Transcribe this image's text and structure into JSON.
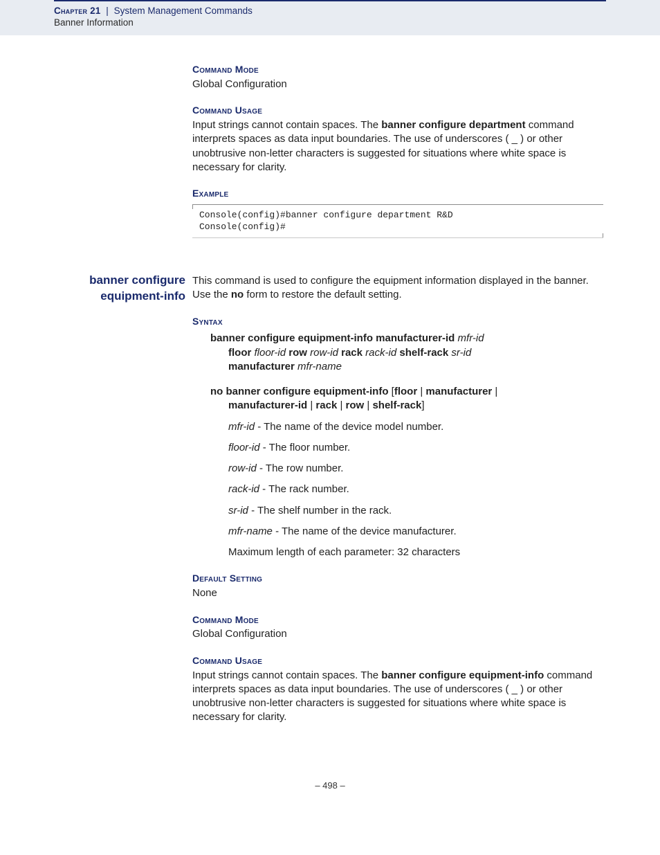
{
  "header": {
    "chapter": "Chapter 21",
    "sep": "|",
    "title": "System Management Commands",
    "sub": "Banner Information"
  },
  "s1": {
    "cmd_mode_label": "Command Mode",
    "cmd_mode_body": "Global Configuration",
    "cmd_usage_label": "Command Usage",
    "usage_pre": "Input strings cannot contain spaces. The ",
    "usage_bold": "banner configure department",
    "usage_post": " command interprets spaces as data input boundaries. The use of underscores ( _ ) or other unobtrusive non-letter characters is suggested for situations where white space is necessary for clarity.",
    "example_label": "Example",
    "code": "Console(config)#banner configure department R&D\nConsole(config)#"
  },
  "cmd2": {
    "side1": "banner configure",
    "side2": "equipment-info",
    "intro_pre": "This command is used to configure the equipment information displayed in the banner. Use the ",
    "intro_bold": "no",
    "intro_post": " form to restore the default setting.",
    "syntax_label": "Syntax",
    "syn1": {
      "p1": "banner configure equipment-info manufacturer-id",
      "i1": "mfr-id",
      "p2": "floor",
      "i2": "floor-id",
      "p3": "row",
      "i3": "row-id",
      "p4": "rack",
      "i4": "rack-id",
      "p5": "shelf-rack",
      "i5": "sr-id",
      "p6": "manufacturer",
      "i6": "mfr-name"
    },
    "syn2": {
      "p1": "no banner configure equipment-info",
      "br1": "[",
      "o1": "floor",
      "sep": " | ",
      "o2": "manufacturer",
      "o3": "manufacturer-id",
      "o4": "rack",
      "o5": "row",
      "o6": "shelf-rack",
      "br2": "]"
    },
    "params": {
      "p1i": "mfr-id",
      "p1t": " - The name of the device model number.",
      "p2i": "floor-id",
      "p2t": " - The floor number.",
      "p3i": "row-id",
      "p3t": " - The row number.",
      "p4i": "rack-id",
      "p4t": " - The rack number.",
      "p5i": "sr-id",
      "p5t": " - The shelf number in the rack.",
      "p6i": "mfr-name",
      "p6t": " - The name of the device manufacturer.",
      "max": "Maximum length of each parameter: 32 characters"
    },
    "default_label": "Default Setting",
    "default_body": "None",
    "cmd_mode_label": "Command Mode",
    "cmd_mode_body": "Global Configuration",
    "cmd_usage_label": "Command Usage",
    "usage_pre": "Input strings cannot contain spaces. The ",
    "usage_bold": "banner configure equipment-info",
    "usage_post": " command interprets spaces as data input boundaries. The use of underscores ( _ ) or other unobtrusive non-letter characters is suggested for situations where white space is necessary for clarity."
  },
  "footer": "–  498  –"
}
